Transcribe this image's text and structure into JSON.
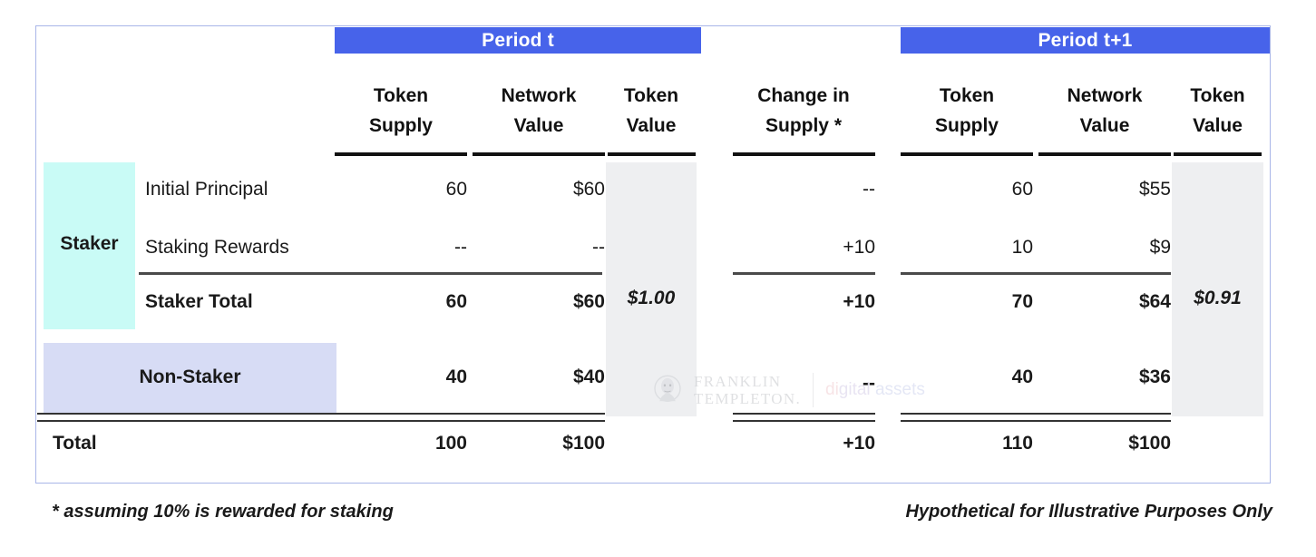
{
  "table": {
    "periods": [
      {
        "label": "Period t"
      },
      {
        "label": "Period t+1"
      }
    ],
    "columns": [
      {
        "id": "token-supply-t",
        "line1": "Token",
        "line2": "Supply"
      },
      {
        "id": "network-value-t",
        "line1": "Network",
        "line2": "Value"
      },
      {
        "id": "token-value-t",
        "line1": "Token",
        "line2": "Value"
      },
      {
        "id": "change-in-supply",
        "line1": "Change in",
        "line2": "Supply *"
      },
      {
        "id": "token-supply-t1",
        "line1": "Token",
        "line2": "Supply"
      },
      {
        "id": "network-value-t1",
        "line1": "Network",
        "line2": "Value"
      },
      {
        "id": "token-value-t1",
        "line1": "Token",
        "line2": "Value"
      }
    ],
    "groups": {
      "staker": "Staker",
      "non_staker": "Non-Staker"
    },
    "rows": [
      {
        "id": "initial-principal",
        "label": "Initial Principal",
        "token_supply_t": "60",
        "network_value_t": "$60",
        "change_in_supply": "--",
        "token_supply_t1": "60",
        "network_value_t1": "$55"
      },
      {
        "id": "staking-rewards",
        "label": "Staking Rewards",
        "token_supply_t": "--",
        "network_value_t": "--",
        "change_in_supply": "+10",
        "token_supply_t1": "10",
        "network_value_t1": "$9"
      },
      {
        "id": "staker-total",
        "label": "Staker Total",
        "token_supply_t": "60",
        "network_value_t": "$60",
        "change_in_supply": "+10",
        "token_supply_t1": "70",
        "network_value_t1": "$64"
      },
      {
        "id": "non-staker",
        "label": "Non-Staker",
        "token_supply_t": "40",
        "network_value_t": "$40",
        "change_in_supply": "--",
        "token_supply_t1": "40",
        "network_value_t1": "$36"
      },
      {
        "id": "total",
        "label": "Total",
        "token_supply_t": "100",
        "network_value_t": "$100",
        "change_in_supply": "+10",
        "token_supply_t1": "110",
        "network_value_t1": "$100"
      }
    ],
    "token_value_t": "$1.00",
    "token_value_t1": "$0.91"
  },
  "watermark": {
    "brand_line1": "FRANKLIN",
    "brand_line2": "TEMPLETON.",
    "tag_part1": "di",
    "tag_part2": "gital ",
    "tag_part3": "assets"
  },
  "footnotes": {
    "left": "* assuming 10% is rewarded for staking",
    "right": "Hypothetical for Illustrative Purposes Only"
  },
  "cutoff": {
    "top1": "",
    "top2": "",
    "top3": "",
    "bottom": ""
  },
  "colors": {
    "period_bar": "#4763ea",
    "staker_block": "#c9fbf6",
    "non_staker_block": "#d7dcf5",
    "gray_column": "#eeeff1",
    "panel_border": "#a9b6e8"
  }
}
